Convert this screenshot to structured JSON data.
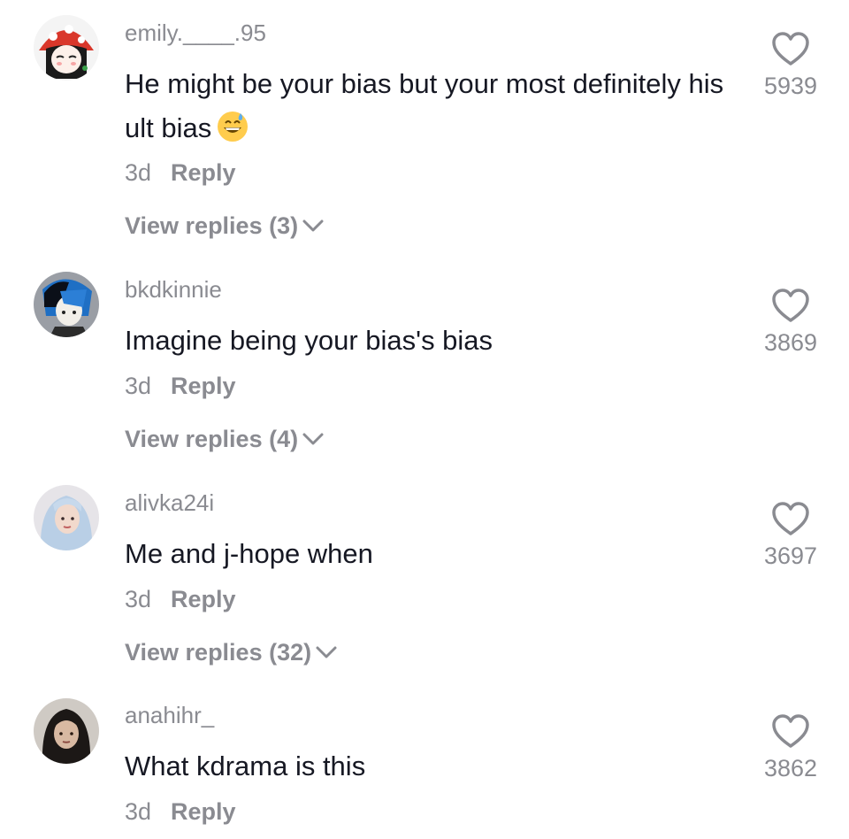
{
  "comments": [
    {
      "username": "emily.____.95",
      "text": "He might be your bias but your most definitely his ult bias",
      "emoji": "grinning-sweat-emoji",
      "time": "3d",
      "reply_label": "Reply",
      "view_replies": "View replies (3)",
      "likes": "5939"
    },
    {
      "username": "bkdkinnie",
      "text": "Imagine being your bias's bias",
      "time": "3d",
      "reply_label": "Reply",
      "view_replies": "View replies (4)",
      "likes": "3869"
    },
    {
      "username": "alivka24i",
      "text": "Me and j-hope when",
      "time": "3d",
      "reply_label": "Reply",
      "view_replies": "View replies (32)",
      "likes": "3697"
    },
    {
      "username": "anahihr_",
      "text": "What kdrama is this",
      "time": "3d",
      "reply_label": "Reply",
      "likes": "3862"
    }
  ],
  "icons": {
    "like": "heart-outline-icon",
    "expand": "chevron-down-icon"
  },
  "colors": {
    "secondary_text": "#8a8b91",
    "primary_text": "#161823"
  }
}
